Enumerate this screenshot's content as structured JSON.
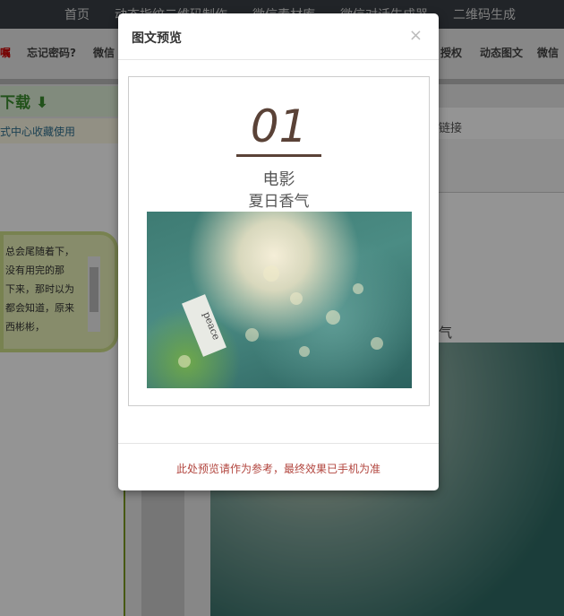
{
  "nav": [
    "首页",
    "动态指纹二维码制作",
    "微信素材库",
    "微信对话生成器",
    "二维码生成"
  ],
  "breadcrumbs": [
    "嘱",
    "忘记密码?",
    "微信",
    "授权",
    "动态图文",
    "微信"
  ],
  "left": {
    "download": "下载",
    "tip": "式中心收藏使用",
    "bubble_lines": [
      "，总会尾随着下",
      "没有用完的那",
      "下来，那时以为",
      "都会知道，原来",
      "，西彬彬"
    ]
  },
  "right": {
    "link_label": "链接",
    "caption": "气"
  },
  "modal": {
    "title": "图文预览",
    "close": "×",
    "number": "01",
    "line1": "电影",
    "line2": "夏日香气",
    "tag_text": "peace",
    "footer": "此处预览请作为参考，最终效果已手机为准"
  }
}
